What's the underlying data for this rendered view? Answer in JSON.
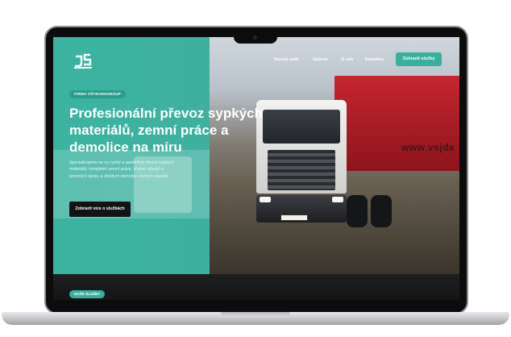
{
  "brand": {
    "logo_icon": "js-truck-logo",
    "accent": "#38b09d"
  },
  "nav": {
    "links": [
      "Vozový park",
      "Galerie",
      "O nás",
      "Kontakty"
    ],
    "cta_label": "Zobrazit služby"
  },
  "hero": {
    "badge": "FIRMA VŠTRANSGROUP",
    "title": "Profesionální převoz sypkých materiálů, zemní práce a demolice na míru",
    "description": "Specializujeme se na rychlý a spolehlivý převoz sypkých materiálů, kompletní zemní práce, včetně výkopů a terénních úprav, a efektivní demolice různých objektů.",
    "cta_label": "Zobrazit více o službách",
    "photo_text": "www.vsjda"
  },
  "services": {
    "badge": "NAŠE SLUŽBY"
  }
}
